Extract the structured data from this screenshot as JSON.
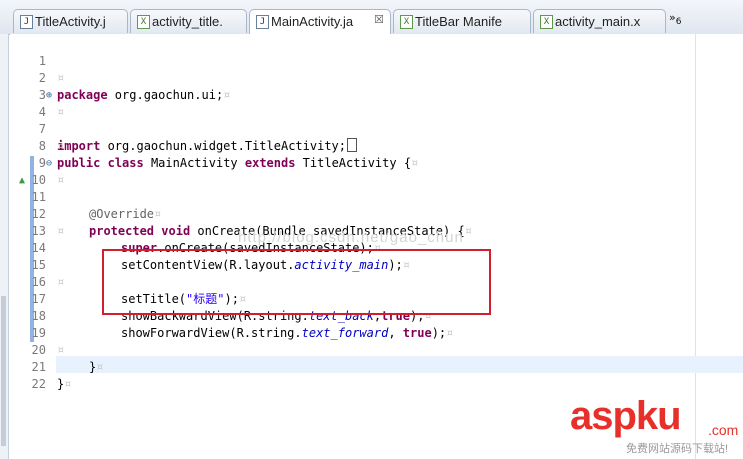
{
  "tabs": [
    {
      "label": "TitleActivity.j",
      "icon": "J",
      "type": "java-file-icon",
      "close": ""
    },
    {
      "label": "activity_title.",
      "icon": "X",
      "type": "xml-file-icon",
      "close": ""
    },
    {
      "label": "MainActivity.ja",
      "icon": "J",
      "type": "java-file-icon",
      "close": "☒"
    },
    {
      "label": "TitleBar Manife",
      "icon": "X",
      "type": "manifest-file-icon",
      "close": ""
    },
    {
      "label": "activity_main.x",
      "icon": "X",
      "type": "xml-file-icon",
      "close": ""
    }
  ],
  "overflow": {
    "chevron": "»",
    "count": "6"
  },
  "code": {
    "l1": "1",
    "l2": "2",
    "l3": "3",
    "l4": "4",
    "l7": "7",
    "l8": "8",
    "l9": "9",
    "l10": "10",
    "l11": "11",
    "l12": "12",
    "l13": "13",
    "l14": "14",
    "l15": "15",
    "l16": "16",
    "l17": "17",
    "l18": "18",
    "l19": "19",
    "l20": "20",
    "l21": "21",
    "l22": "22",
    "pkg_kw": "package",
    "pkg_name": " org.gaochun.ui;",
    "imp_kw": "import",
    "imp_name": " org.gaochun.widget.TitleActivity;",
    "cls_pub": "public",
    "cls_class": "class",
    "cls_name": " MainActivity ",
    "cls_ext": "extends",
    "cls_parent": " TitleActivity {",
    "override": "@Override",
    "prot": "protected",
    "void": "void",
    "method_sig": " onCreate(Bundle savedInstanceState) {",
    "super_kw": "super",
    "super_call": ".onCreate(savedInstanceState);",
    "setcontent_a": "setContentView(R.layout.",
    "setcontent_field": "activity_main",
    "setcontent_b": ");",
    "settitle_a": "setTitle(",
    "settitle_str": "\"标题\"",
    "settitle_b": ");",
    "back_a": "showBackwardView(R.string.",
    "back_field": "text_back",
    "back_b": ",",
    "back_true": "true",
    "back_c": ");",
    "fwd_a": "showForwardView(R.string.",
    "fwd_field": "text_forward",
    "fwd_b": ", ",
    "fwd_true": "true",
    "fwd_c": ");",
    "close_method": "}",
    "close_class": "}",
    "pilcrow": "¤"
  },
  "watermark": "http://blog.csdn.net/gao_chun",
  "brand": {
    "asp": "aspku",
    "com": ".com",
    "tagline": "免费网站源码下载站!"
  },
  "colors": {
    "keyword": "#7f0055",
    "field": "#0000c0",
    "string": "#2a00ff",
    "highlight_box": "#d0202e",
    "brand": "#e8302a"
  }
}
